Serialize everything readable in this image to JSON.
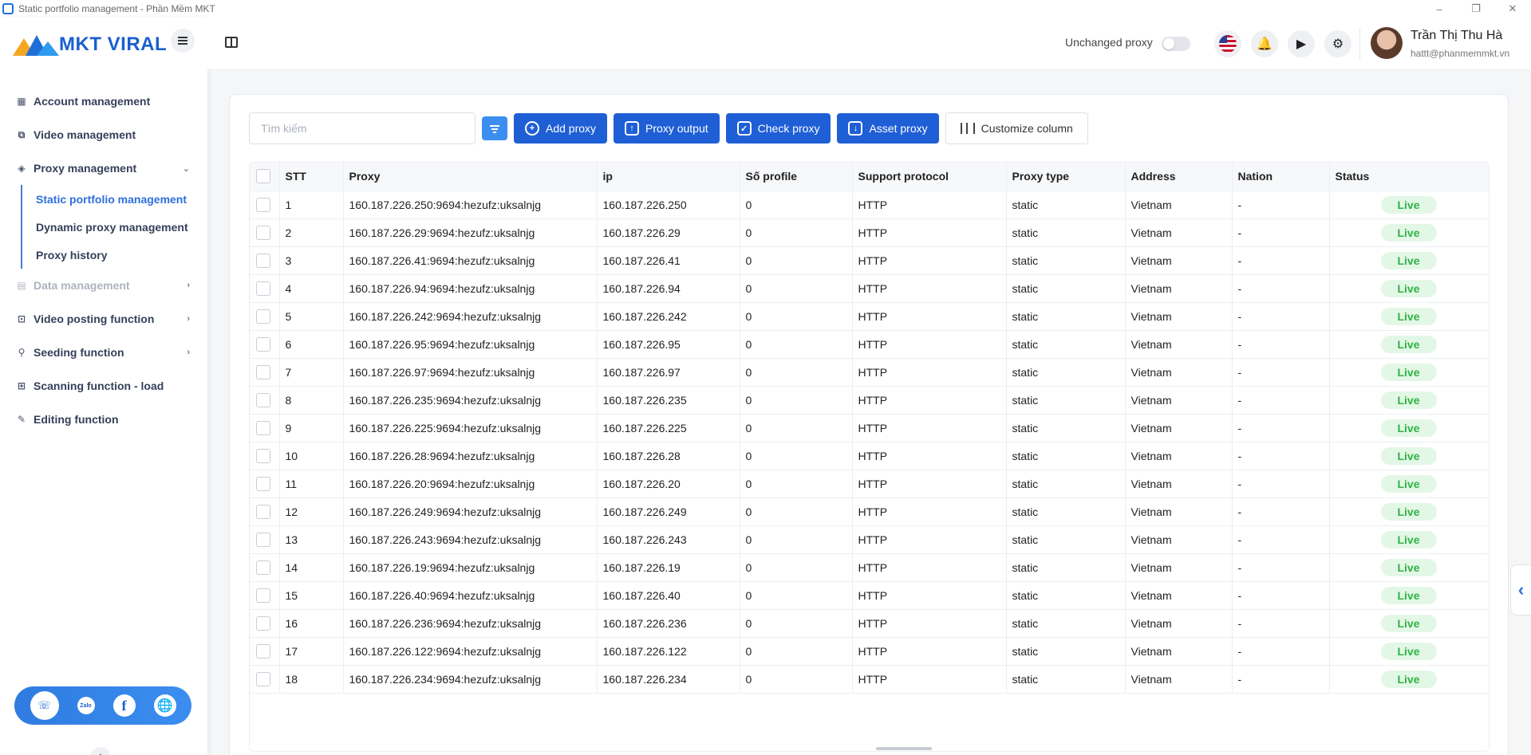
{
  "window": {
    "title": "Static portfolio management - Phần Mềm MKT",
    "minimize": "–",
    "restore": "❐",
    "close": "✕"
  },
  "sidebar": {
    "logo_text": "MKT VIRAL",
    "items": [
      {
        "label": "Account management",
        "icon": "grid-icon"
      },
      {
        "label": "Video management",
        "icon": "video-icon"
      },
      {
        "label": "Proxy management",
        "icon": "layers-icon",
        "chevron": "⌄"
      },
      {
        "label": "Data management",
        "icon": "data-icon",
        "chevron": "›"
      },
      {
        "label": "Video posting function",
        "icon": "upload-icon",
        "chevron": "›"
      },
      {
        "label": "Seeding function",
        "icon": "share-icon",
        "chevron": "›"
      },
      {
        "label": "Scanning function - load",
        "icon": "scan-icon"
      },
      {
        "label": "Editing function",
        "icon": "pencil-icon"
      }
    ],
    "subitems": [
      {
        "label": "Static portfolio management",
        "active": true
      },
      {
        "label": "Dynamic proxy management",
        "active": false
      },
      {
        "label": "Proxy history",
        "active": false
      }
    ],
    "social": {
      "support": "support-icon",
      "zalo": "Zalo",
      "facebook": "f",
      "globe": "globe-icon"
    },
    "collapse": "⌃"
  },
  "header": {
    "unchanged_proxy_label": "Unchanged proxy",
    "unchanged_proxy_on": false,
    "user_name": "Trần Thị Thu Hà",
    "user_email": "hattt@phanmemmkt.vn"
  },
  "toolbar": {
    "search_placeholder": "Tìm kiếm",
    "add_proxy": "Add proxy",
    "proxy_output": "Proxy output",
    "check_proxy": "Check proxy",
    "asset_proxy": "Asset proxy",
    "customize_column": "Customize column"
  },
  "table": {
    "columns": [
      "STT",
      "Proxy",
      "ip",
      "Số profile",
      "Support protocol",
      "Proxy type",
      "Address",
      "Nation",
      "Status"
    ],
    "rows": [
      {
        "stt": "1",
        "proxy": "160.187.226.250:9694:hezufz:uksalnjg",
        "ip": "160.187.226.250",
        "profiles": "0",
        "protocol": "HTTP",
        "type": "static",
        "address": "Vietnam",
        "nation": "-",
        "status": "Live"
      },
      {
        "stt": "2",
        "proxy": "160.187.226.29:9694:hezufz:uksalnjg",
        "ip": "160.187.226.29",
        "profiles": "0",
        "protocol": "HTTP",
        "type": "static",
        "address": "Vietnam",
        "nation": "-",
        "status": "Live"
      },
      {
        "stt": "3",
        "proxy": "160.187.226.41:9694:hezufz:uksalnjg",
        "ip": "160.187.226.41",
        "profiles": "0",
        "protocol": "HTTP",
        "type": "static",
        "address": "Vietnam",
        "nation": "-",
        "status": "Live"
      },
      {
        "stt": "4",
        "proxy": "160.187.226.94:9694:hezufz:uksalnjg",
        "ip": "160.187.226.94",
        "profiles": "0",
        "protocol": "HTTP",
        "type": "static",
        "address": "Vietnam",
        "nation": "-",
        "status": "Live"
      },
      {
        "stt": "5",
        "proxy": "160.187.226.242:9694:hezufz:uksalnjg",
        "ip": "160.187.226.242",
        "profiles": "0",
        "protocol": "HTTP",
        "type": "static",
        "address": "Vietnam",
        "nation": "-",
        "status": "Live"
      },
      {
        "stt": "6",
        "proxy": "160.187.226.95:9694:hezufz:uksalnjg",
        "ip": "160.187.226.95",
        "profiles": "0",
        "protocol": "HTTP",
        "type": "static",
        "address": "Vietnam",
        "nation": "-",
        "status": "Live"
      },
      {
        "stt": "7",
        "proxy": "160.187.226.97:9694:hezufz:uksalnjg",
        "ip": "160.187.226.97",
        "profiles": "0",
        "protocol": "HTTP",
        "type": "static",
        "address": "Vietnam",
        "nation": "-",
        "status": "Live"
      },
      {
        "stt": "8",
        "proxy": "160.187.226.235:9694:hezufz:uksalnjg",
        "ip": "160.187.226.235",
        "profiles": "0",
        "protocol": "HTTP",
        "type": "static",
        "address": "Vietnam",
        "nation": "-",
        "status": "Live"
      },
      {
        "stt": "9",
        "proxy": "160.187.226.225:9694:hezufz:uksalnjg",
        "ip": "160.187.226.225",
        "profiles": "0",
        "protocol": "HTTP",
        "type": "static",
        "address": "Vietnam",
        "nation": "-",
        "status": "Live"
      },
      {
        "stt": "10",
        "proxy": "160.187.226.28:9694:hezufz:uksalnjg",
        "ip": "160.187.226.28",
        "profiles": "0",
        "protocol": "HTTP",
        "type": "static",
        "address": "Vietnam",
        "nation": "-",
        "status": "Live"
      },
      {
        "stt": "11",
        "proxy": "160.187.226.20:9694:hezufz:uksalnjg",
        "ip": "160.187.226.20",
        "profiles": "0",
        "protocol": "HTTP",
        "type": "static",
        "address": "Vietnam",
        "nation": "-",
        "status": "Live"
      },
      {
        "stt": "12",
        "proxy": "160.187.226.249:9694:hezufz:uksalnjg",
        "ip": "160.187.226.249",
        "profiles": "0",
        "protocol": "HTTP",
        "type": "static",
        "address": "Vietnam",
        "nation": "-",
        "status": "Live"
      },
      {
        "stt": "13",
        "proxy": "160.187.226.243:9694:hezufz:uksalnjg",
        "ip": "160.187.226.243",
        "profiles": "0",
        "protocol": "HTTP",
        "type": "static",
        "address": "Vietnam",
        "nation": "-",
        "status": "Live"
      },
      {
        "stt": "14",
        "proxy": "160.187.226.19:9694:hezufz:uksalnjg",
        "ip": "160.187.226.19",
        "profiles": "0",
        "protocol": "HTTP",
        "type": "static",
        "address": "Vietnam",
        "nation": "-",
        "status": "Live"
      },
      {
        "stt": "15",
        "proxy": "160.187.226.40:9694:hezufz:uksalnjg",
        "ip": "160.187.226.40",
        "profiles": "0",
        "protocol": "HTTP",
        "type": "static",
        "address": "Vietnam",
        "nation": "-",
        "status": "Live"
      },
      {
        "stt": "16",
        "proxy": "160.187.226.236:9694:hezufz:uksalnjg",
        "ip": "160.187.226.236",
        "profiles": "0",
        "protocol": "HTTP",
        "type": "static",
        "address": "Vietnam",
        "nation": "-",
        "status": "Live"
      },
      {
        "stt": "17",
        "proxy": "160.187.226.122:9694:hezufz:uksalnjg",
        "ip": "160.187.226.122",
        "profiles": "0",
        "protocol": "HTTP",
        "type": "static",
        "address": "Vietnam",
        "nation": "-",
        "status": "Live"
      },
      {
        "stt": "18",
        "proxy": "160.187.226.234:9694:hezufz:uksalnjg",
        "ip": "160.187.226.234",
        "profiles": "0",
        "protocol": "HTTP",
        "type": "static",
        "address": "Vietnam",
        "nation": "-",
        "status": "Live"
      }
    ]
  },
  "side_tab": "‹",
  "colors": {
    "accent": "#1f5fd6",
    "live_bg": "#e3f7e6",
    "live_text": "#2fb344"
  }
}
